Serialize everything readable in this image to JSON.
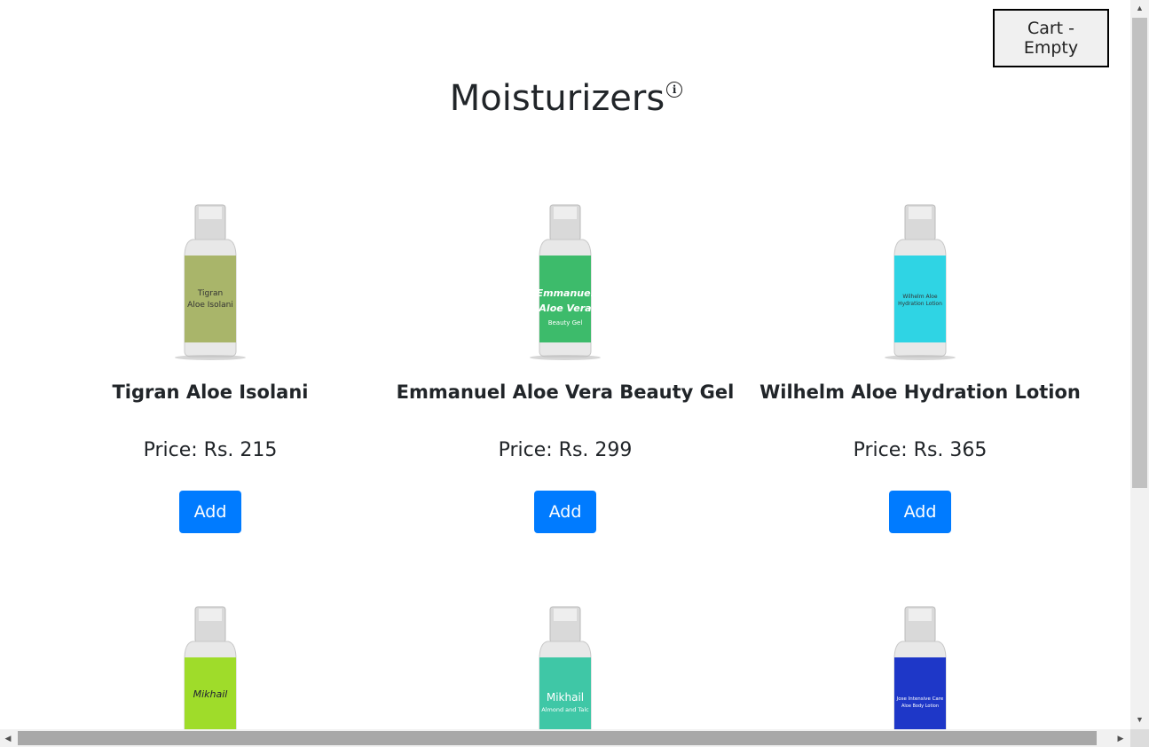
{
  "cart": {
    "label": "Cart - Empty"
  },
  "page": {
    "title": "Moisturizers",
    "info_glyph": "i"
  },
  "products": [
    {
      "name": "Tigran Aloe Isolani",
      "price": "Price: Rs. 215",
      "add_label": "Add",
      "label_color": "#a9b56a",
      "label_text_1": "Tigran",
      "label_text_2": "Aloe Isolani",
      "label_text_3": ""
    },
    {
      "name": "Emmanuel Aloe Vera Beauty Gel",
      "price": "Price: Rs. 299",
      "add_label": "Add",
      "label_color": "#3dbb6b",
      "label_text_1": "Emmanuel",
      "label_text_2": "Aloe Vera",
      "label_text_3": "Beauty Gel"
    },
    {
      "name": "Wilhelm Aloe Hydration Lotion",
      "price": "Price: Rs. 365",
      "add_label": "Add",
      "label_color": "#2fd4e4",
      "label_text_1": "Wilhelm Aloe",
      "label_text_2": "Hydration Lotion",
      "label_text_3": ""
    },
    {
      "name": "",
      "price": "",
      "add_label": "",
      "label_color": "#9fdc2a",
      "label_text_1": "Mikhail",
      "label_text_2": "",
      "label_text_3": ""
    },
    {
      "name": "",
      "price": "",
      "add_label": "",
      "label_color": "#3fc7a6",
      "label_text_1": "Mikhail",
      "label_text_2": "Almond and Talc",
      "label_text_3": ""
    },
    {
      "name": "",
      "price": "",
      "add_label": "",
      "label_color": "#1e37c8",
      "label_text_1": "Jose Intensive Care",
      "label_text_2": "Aloe Body Lotion",
      "label_text_3": ""
    }
  ]
}
